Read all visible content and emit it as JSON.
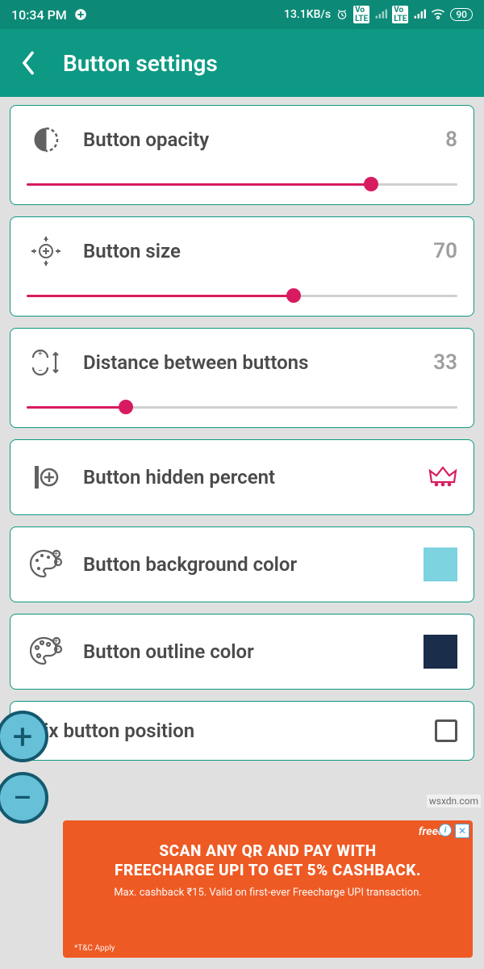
{
  "status": {
    "time": "10:34 PM",
    "net_speed": "13.1KB/s",
    "battery": "90"
  },
  "header": {
    "title": "Button settings"
  },
  "settings": {
    "opacity": {
      "label": "Button opacity",
      "value": "8",
      "percent": 80
    },
    "size": {
      "label": "Button size",
      "value": "70",
      "percent": 62
    },
    "distance": {
      "label": "Distance between buttons",
      "value": "33",
      "percent": 23
    },
    "hidden": {
      "label": "Button hidden percent"
    },
    "bg": {
      "label": "Button background color",
      "color": "#7dd3e0"
    },
    "outline": {
      "label": "Button outline color",
      "color": "#1a2d4a"
    },
    "fix": {
      "label": "Fix button position",
      "checked": false
    }
  },
  "ad": {
    "brand": "freecharge",
    "line1": "SCAN ANY QR AND PAY WITH",
    "line2": "FREECHARGE UPI TO GET 5% CASHBACK.",
    "sub": "Max. cashback ₹15. Valid on first-ever Freecharge UPI transaction.",
    "tnc": "*T&C Apply"
  },
  "watermark": "wsxdn.com"
}
